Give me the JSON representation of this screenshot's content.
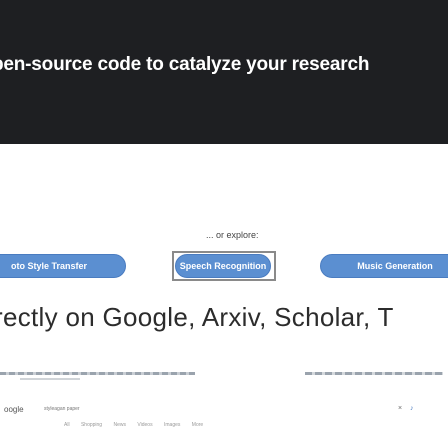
{
  "hero": {
    "title": "pen-source code to catalyze your research"
  },
  "explore": {
    "label": "... or explore:"
  },
  "pills": [
    {
      "label": "oto Style Transfer"
    },
    {
      "label": "Speech Recognition"
    },
    {
      "label": "Music Generation"
    }
  ],
  "headline": {
    "text": "rectly on Google, Arxiv, Scholar, T"
  },
  "browser_preview": {
    "logo": "oogle",
    "query": "styleagan paper",
    "close": "×",
    "mic": "♪",
    "tabs": [
      "All",
      "Shopping",
      "News",
      "Videos",
      "Images",
      "More"
    ]
  }
}
